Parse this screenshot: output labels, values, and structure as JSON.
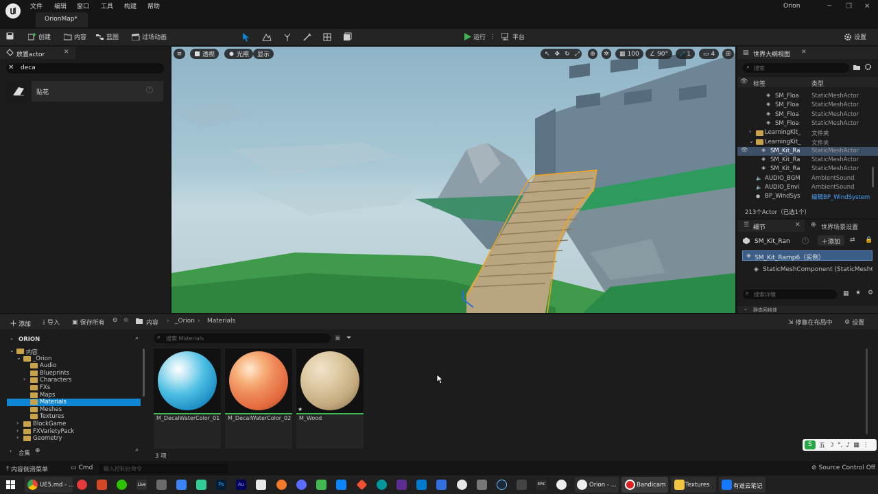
{
  "menubar": {
    "items": [
      "文件",
      "编辑",
      "窗口",
      "工具",
      "构建",
      "帮助"
    ],
    "map_tab": "OrionMap*",
    "project_name": "Orion"
  },
  "toolbar": {
    "save_icon": "save-icon",
    "create": "创建",
    "content": "内容",
    "blueprint": "蓝图",
    "cinematics": "过场动画",
    "run": "运行",
    "platform": "平台",
    "settings": "设置"
  },
  "place_actors": {
    "tab_title": "放置actor",
    "search_value": "deca",
    "result_label": "贴花"
  },
  "viewport": {
    "perspective": "透视",
    "lit": "光照",
    "show": "显示",
    "grid_size": "100",
    "rotation_snap": "90°",
    "scale_snap": "1",
    "camera_speed": "4"
  },
  "outliner": {
    "title": "世界大纲视图",
    "search_placeholder": "搜索",
    "col_label": "标签",
    "col_type": "类型",
    "rows": [
      {
        "name": "SM_Floa",
        "type": "StaticMeshActor",
        "indent": 55,
        "kind": "mesh",
        "selected": false,
        "eye": false
      },
      {
        "name": "SM_Floa",
        "type": "StaticMeshActor",
        "indent": 55,
        "kind": "mesh",
        "selected": false,
        "eye": false
      },
      {
        "name": "SM_Floa",
        "type": "StaticMeshActor",
        "indent": 55,
        "kind": "mesh",
        "selected": false,
        "eye": false
      },
      {
        "name": "SM_Floa",
        "type": "StaticMeshActor",
        "indent": 55,
        "kind": "mesh",
        "selected": false,
        "eye": false
      },
      {
        "name": "LearningKit_",
        "type": "文件夹",
        "indent": 40,
        "kind": "folder",
        "selected": false,
        "eye": false
      },
      {
        "name": "LearningKit_",
        "type": "文件夹",
        "indent": 40,
        "kind": "folder-open",
        "selected": false,
        "eye": false
      },
      {
        "name": "SM_Kit_Ra",
        "type": "StaticMeshActor",
        "indent": 48,
        "kind": "mesh",
        "selected": true,
        "eye": true
      },
      {
        "name": "SM_Kit_Ra",
        "type": "StaticMeshActor",
        "indent": 48,
        "kind": "mesh",
        "selected": false,
        "eye": false
      },
      {
        "name": "SM_Kit_Ra",
        "type": "StaticMeshActor",
        "indent": 48,
        "kind": "mesh",
        "selected": false,
        "eye": false
      },
      {
        "name": "AUDIO_BGM",
        "type": "AmbientSound",
        "indent": 40,
        "kind": "audio",
        "selected": false,
        "eye": false
      },
      {
        "name": "AUDIO_Envi",
        "type": "AmbientSound",
        "indent": 40,
        "kind": "audio",
        "selected": false,
        "eye": false
      },
      {
        "name": "BP_WindSys",
        "type": "编辑BP_WindSystem",
        "indent": 40,
        "kind": "bp",
        "selected": false,
        "eye": false
      }
    ],
    "footer": "213个Actor（已选1个）"
  },
  "details": {
    "tab_details": "细节",
    "tab_world_settings": "世界场景设置",
    "actor_name": "SM_Kit_Ran",
    "add_label": "添加",
    "instance_label": "SM_Kit_Ramp6（实例）",
    "component_label": "StaticMeshComponent (StaticMeshCor",
    "search_placeholder": "搜索详情",
    "section_label": "静态网格体"
  },
  "content_browser": {
    "add": "添加",
    "import": "导入",
    "save_all": "保存所有",
    "breadcrumb": [
      "内容",
      "_Orion",
      "Materials"
    ],
    "dock": "停靠在布局中",
    "settings": "设置",
    "tree_title": "ORION",
    "search_placeholder": "搜索 Materials",
    "tree": [
      {
        "label": "内容",
        "depth": 0,
        "expanded": true,
        "selected": false
      },
      {
        "label": "_Orion",
        "depth": 1,
        "expanded": true,
        "selected": false
      },
      {
        "label": "Audio",
        "depth": 2,
        "expanded": false,
        "selected": false
      },
      {
        "label": "Blueprints",
        "depth": 2,
        "expanded": false,
        "selected": false
      },
      {
        "label": "Characters",
        "depth": 2,
        "expanded": false,
        "selected": false,
        "arrow": true
      },
      {
        "label": "FXs",
        "depth": 2,
        "expanded": false,
        "selected": false
      },
      {
        "label": "Maps",
        "depth": 2,
        "expanded": false,
        "selected": false
      },
      {
        "label": "Materials",
        "depth": 2,
        "expanded": false,
        "selected": true
      },
      {
        "label": "Meshes",
        "depth": 2,
        "expanded": false,
        "selected": false
      },
      {
        "label": "Textures",
        "depth": 2,
        "expanded": false,
        "selected": false
      },
      {
        "label": "BlockGame",
        "depth": 1,
        "expanded": false,
        "selected": false,
        "arrow": true
      },
      {
        "label": "FXVarietyPack",
        "depth": 1,
        "expanded": false,
        "selected": false,
        "arrow": true
      },
      {
        "label": "Geometry",
        "depth": 1,
        "expanded": false,
        "selected": false,
        "arrow": true
      }
    ],
    "collections": "合集",
    "assets": [
      {
        "name": "M_DecalWaterColor_01"
      },
      {
        "name": "M_DecalWaterColor_02"
      },
      {
        "name": "M_Wood"
      }
    ],
    "item_count": "3 项"
  },
  "statusbar": {
    "drawer": "内容侧滑菜单",
    "cmd": "Cmd",
    "console_placeholder": "输入控制台命令",
    "source_control": "Source Control Off"
  },
  "taskbar": {
    "chrome_label": "UE5.md - ...",
    "orion_label": "Orion - ...",
    "bandicam_label": "Bandicam",
    "textures_label": "Textures",
    "youdao_label": "有道云笔记"
  },
  "colors": {
    "accent_blue": "#0e86d4",
    "selection_orange": "#f2a51a",
    "run_green": "#3fb950"
  }
}
